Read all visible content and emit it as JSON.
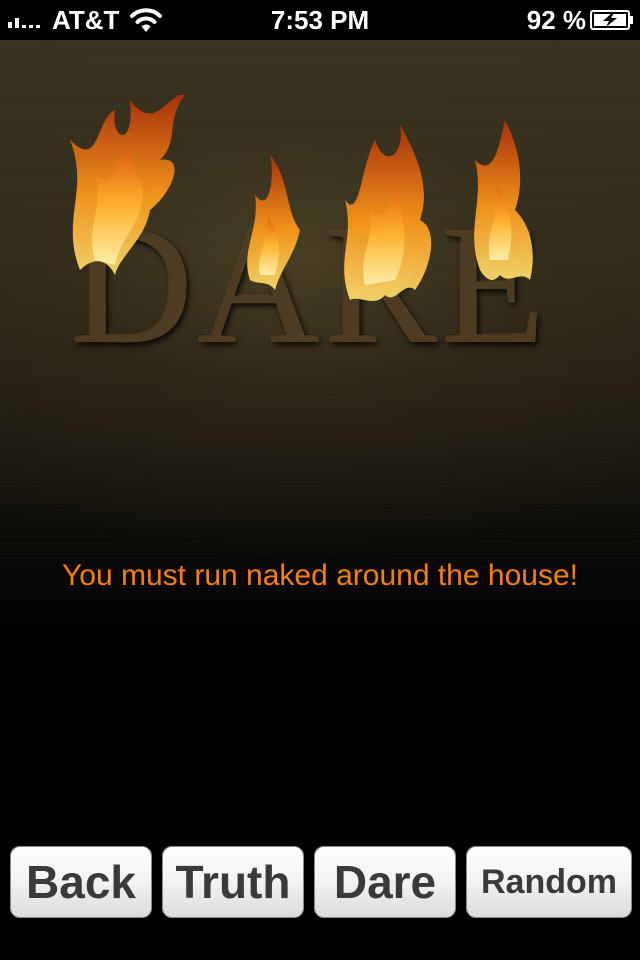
{
  "status_bar": {
    "carrier": "AT&T",
    "time": "7:53 PM",
    "battery_percent": "92 %",
    "icons": [
      "signal-icon",
      "wifi-icon",
      "battery-charging-icon"
    ]
  },
  "logo": {
    "text": "DARE",
    "style": "flaming-letters"
  },
  "message": {
    "text": "You must run naked around the house!",
    "color": "#f27f10"
  },
  "buttons": {
    "back": "Back",
    "truth": "Truth",
    "dare": "Dare",
    "random": "Random"
  }
}
